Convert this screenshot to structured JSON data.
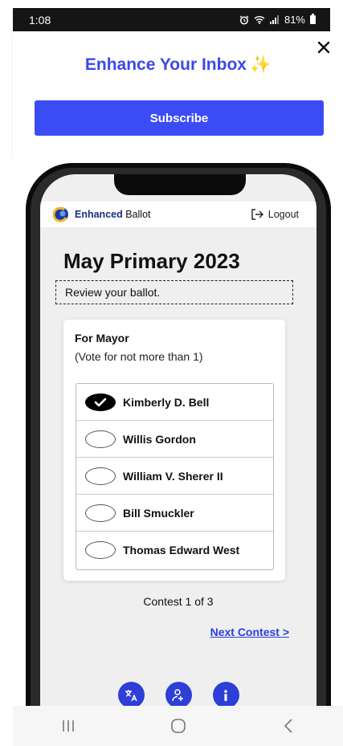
{
  "status_bar": {
    "time": "1:08",
    "battery": "81%",
    "icons": [
      "alarm-icon",
      "wifi-icon",
      "signal-icon",
      "battery-icon"
    ]
  },
  "promo": {
    "title": "Enhance Your Inbox",
    "sparkle": "✨",
    "subscribe_label": "Subscribe",
    "accent_color": "#3c4cf5"
  },
  "app": {
    "brand_bold": "Enhanced",
    "brand_rest": " Ballot",
    "logout_label": "Logout",
    "ballot_title": "May Primary 2023",
    "review_text": "Review your ballot.",
    "contest": {
      "name": "For Mayor",
      "rule": "(Vote for not more than 1)",
      "candidates": [
        {
          "name": "Kimberly D. Bell",
          "selected": true
        },
        {
          "name": "Willis Gordon",
          "selected": false
        },
        {
          "name": "William V. Sherer II",
          "selected": false
        },
        {
          "name": "Bill Smuckler",
          "selected": false
        },
        {
          "name": "Thomas Edward West",
          "selected": false
        }
      ]
    },
    "contest_counter": "Contest 1 of 3",
    "next_label": "Next Contest >",
    "tools": [
      "translate-icon",
      "accessibility-icon",
      "info-icon"
    ]
  },
  "nav": [
    "recent-apps-icon",
    "home-icon",
    "back-icon"
  ]
}
